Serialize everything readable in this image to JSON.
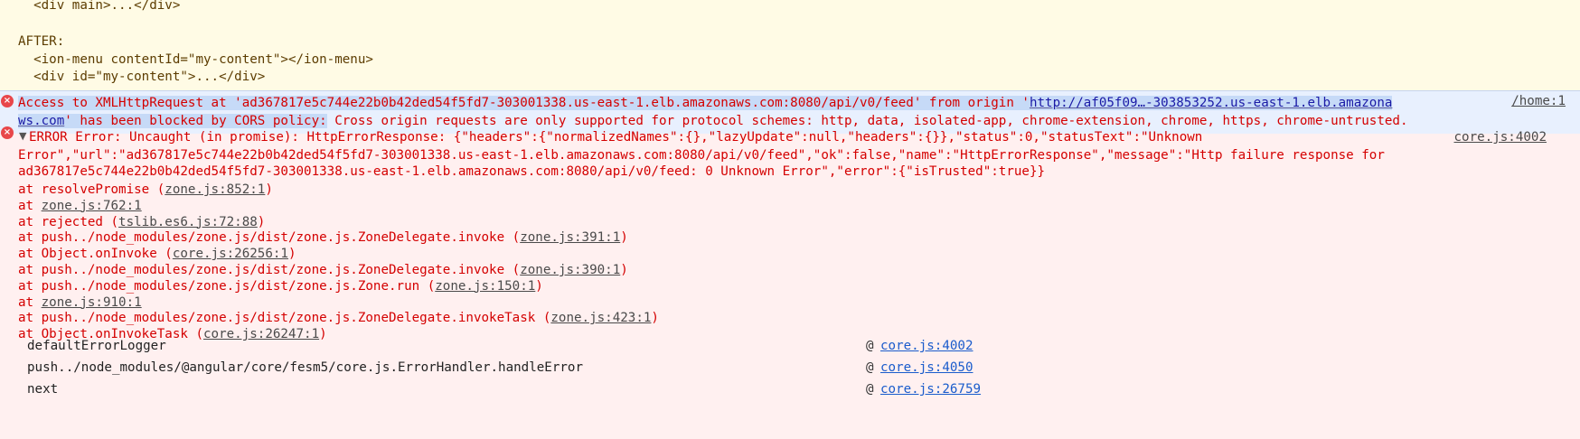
{
  "warning": {
    "line1": "  <div main>...</div>",
    "line2": "AFTER:",
    "line3": "  <ion-menu contentId=\"my-content\"></ion-menu>",
    "line4": "  <div id=\"my-content\">...</div>"
  },
  "cors_error": {
    "prefix": "Access to XMLHttpRequest at 'ad367817e5c744e22b0b42ded54f5fd7-303001338.us-east-1.elb.amazonaws.com:8080/api/v0/feed' from origin '",
    "origin_link_part1": "http://af05f09…-303853252.us-east-1.elb.amazona",
    "origin_link_part2": "ws.com",
    "mid": "' has been blocked by CORS policy:",
    "rest": " Cross origin requests are only supported for protocol schemes: http, data, isolated-app, chrome-extension, chrome, https, chrome-untrusted.",
    "source": "/home:1"
  },
  "uncaught": {
    "toggle": "▼",
    "line1": "ERROR Error: Uncaught (in promise): HttpErrorResponse: {\"headers\":{\"normalizedNames\":{},\"lazyUpdate\":null,\"headers\":{}},\"status\":0,\"statusText\":\"Unknown",
    "line2": "Error\",\"url\":\"ad367817e5c744e22b0b42ded54f5fd7-303001338.us-east-1.elb.amazonaws.com:8080/api/v0/feed\",\"ok\":false,\"name\":\"HttpErrorResponse\",\"message\":\"Http failure response for",
    "line3": "ad367817e5c744e22b0b42ded54f5fd7-303001338.us-east-1.elb.amazonaws.com:8080/api/v0/feed: 0 Unknown Error\",\"error\":{\"isTrusted\":true}}",
    "source": "core.js:4002",
    "stack": [
      {
        "text": "at resolvePromise (",
        "link": "zone.js:852:1",
        "tail": ")"
      },
      {
        "text": "at ",
        "link": "zone.js:762:1",
        "tail": ""
      },
      {
        "text": "at rejected (",
        "link": "tslib.es6.js:72:88",
        "tail": ")"
      },
      {
        "text": "at push../node_modules/zone.js/dist/zone.js.ZoneDelegate.invoke (",
        "link": "zone.js:391:1",
        "tail": ")"
      },
      {
        "text": "at Object.onInvoke (",
        "link": "core.js:26256:1",
        "tail": ")"
      },
      {
        "text": "at push../node_modules/zone.js/dist/zone.js.ZoneDelegate.invoke (",
        "link": "zone.js:390:1",
        "tail": ")"
      },
      {
        "text": "at push../node_modules/zone.js/dist/zone.js.Zone.run (",
        "link": "zone.js:150:1",
        "tail": ")"
      },
      {
        "text": "at ",
        "link": "zone.js:910:1",
        "tail": ""
      },
      {
        "text": "at push../node_modules/zone.js/dist/zone.js.ZoneDelegate.invokeTask (",
        "link": "zone.js:423:1",
        "tail": ")"
      },
      {
        "text": "at Object.onInvokeTask (",
        "link": "core.js:26247:1",
        "tail": ")"
      }
    ]
  },
  "call_trace": [
    {
      "fn": "defaultErrorLogger",
      "at": "@",
      "link": "core.js:4002"
    },
    {
      "fn": "push../node_modules/@angular/core/fesm5/core.js.ErrorHandler.handleError",
      "at": "@",
      "link": "core.js:4050"
    },
    {
      "fn": "next",
      "at": "@",
      "link": "core.js:26759"
    }
  ]
}
